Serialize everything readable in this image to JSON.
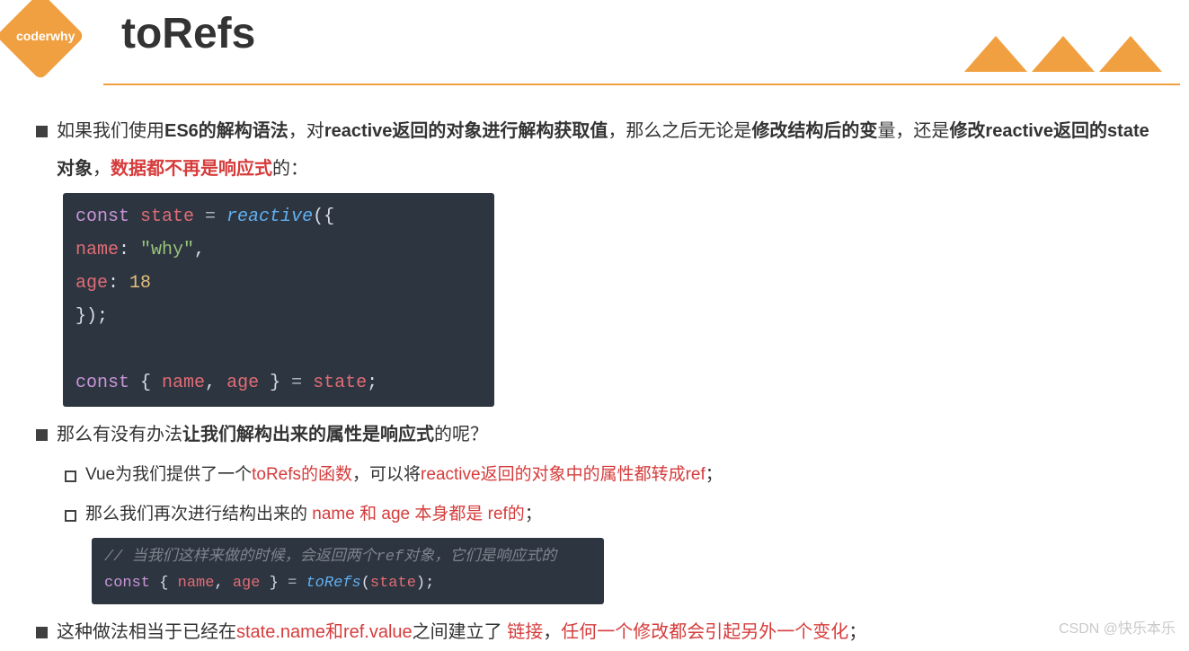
{
  "logo_text": "coderwhy",
  "title": "toRefs",
  "p1": {
    "t1": "如果我们使用",
    "t2": "ES6的解构语法",
    "t3": "，对",
    "t4": "reactive返回的对象进行解构获取值",
    "t5": "，那么之后无论是",
    "t6": "修改结构后的变",
    "t7": "量，还是",
    "t8": "修改reactive返回的state对象",
    "t9": "，",
    "t10": "数据都不再是响应式",
    "t11": "的："
  },
  "code1": {
    "kw1": "const",
    "var1": " state ",
    "op1": "=",
    "fn1": " reactive",
    "p1": "({",
    "indent": "  ",
    "var2": "name",
    "p2": ": ",
    "str1": "\"why\"",
    "p3": ",",
    "var3": "age",
    "p4": ": ",
    "num1": "18",
    "p5": "});",
    "kw2": "const",
    "p6": " { ",
    "var4": "name",
    "p7": ", ",
    "var5": "age",
    "p8": " } ",
    "op2": "=",
    "var6": " state",
    "p9": ";"
  },
  "p2": {
    "t1": "那么有没有办法",
    "t2": "让我们解构出来的属性是响应式",
    "t3": "的呢？"
  },
  "p3": {
    "t1": "Vue为我们提供了一个",
    "t2": "toRefs的函数",
    "t3": "，可以将",
    "t4": "reactive返回的对象中的属性都转成ref",
    "t5": "；"
  },
  "p4": {
    "t1": "那么我们再次进行结构出来的",
    "t2": " name 和 age 本身都是 ref的",
    "t3": "；"
  },
  "code2": {
    "comment": "// 当我们这样来做的时候，会返回两个ref对象，它们是响应式的",
    "kw1": "const",
    "p1": " { ",
    "var1": "name",
    "p2": ", ",
    "var2": "age",
    "p3": " } ",
    "op1": "=",
    "fn1": " toRefs",
    "p4": "(",
    "var3": "state",
    "p5": ");"
  },
  "p5": {
    "t1": "这种做法相当于已经在",
    "t2": "state.name和ref.value",
    "t3": "之间建立了",
    "t4": " 链接",
    "t5": "，",
    "t6": "任何一个修改都会引起另外一个变化",
    "t7": "；"
  },
  "watermark": "CSDN @快乐本乐"
}
